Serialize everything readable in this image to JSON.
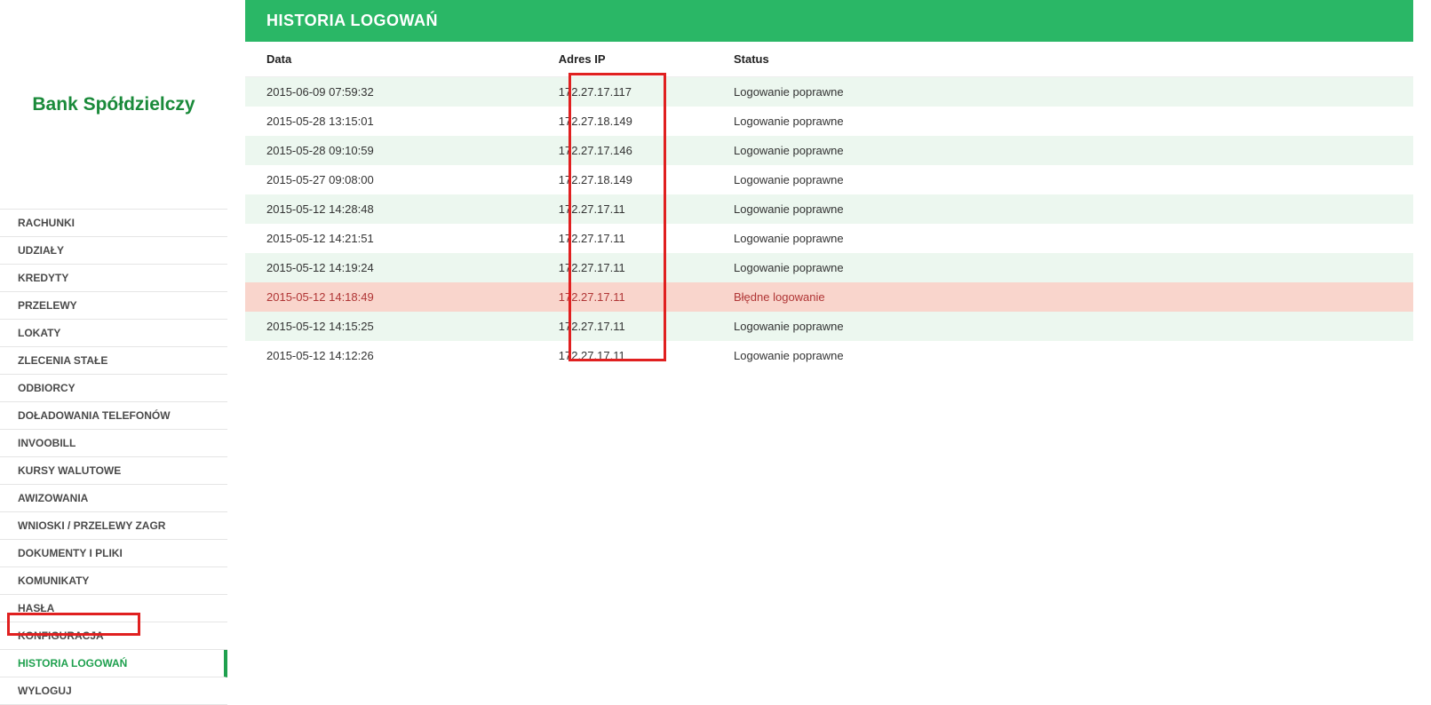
{
  "brand": "Bank Spółdzielczy",
  "page_title": "HISTORIA LOGOWAŃ",
  "nav": [
    {
      "label": "RACHUNKI",
      "active": false
    },
    {
      "label": "UDZIAŁY",
      "active": false
    },
    {
      "label": "KREDYTY",
      "active": false
    },
    {
      "label": "PRZELEWY",
      "active": false
    },
    {
      "label": "LOKATY",
      "active": false
    },
    {
      "label": "ZLECENIA STAŁE",
      "active": false
    },
    {
      "label": "ODBIORCY",
      "active": false
    },
    {
      "label": "DOŁADOWANIA TELEFONÓW",
      "active": false
    },
    {
      "label": "INVOOBILL",
      "active": false
    },
    {
      "label": "KURSY WALUTOWE",
      "active": false
    },
    {
      "label": "AWIZOWANIA",
      "active": false
    },
    {
      "label": "WNIOSKI / PRZELEWY ZAGR",
      "active": false
    },
    {
      "label": "DOKUMENTY I PLIKI",
      "active": false
    },
    {
      "label": "KOMUNIKATY",
      "active": false
    },
    {
      "label": "HASŁA",
      "active": false
    },
    {
      "label": "KONFIGURACJA",
      "active": false
    },
    {
      "label": "HISTORIA LOGOWAŃ",
      "active": true
    },
    {
      "label": "WYLOGUJ",
      "active": false
    }
  ],
  "columns": {
    "date": "Data",
    "ip": "Adres IP",
    "status": "Status"
  },
  "rows": [
    {
      "date": "2015-06-09 07:59:32",
      "ip": "172.27.17.117",
      "status": "Logowanie poprawne",
      "type": "alt"
    },
    {
      "date": "2015-05-28 13:15:01",
      "ip": "172.27.18.149",
      "status": "Logowanie poprawne",
      "type": ""
    },
    {
      "date": "2015-05-28 09:10:59",
      "ip": "172.27.17.146",
      "status": "Logowanie poprawne",
      "type": "alt"
    },
    {
      "date": "2015-05-27 09:08:00",
      "ip": "172.27.18.149",
      "status": "Logowanie poprawne",
      "type": ""
    },
    {
      "date": "2015-05-12 14:28:48",
      "ip": "172.27.17.11",
      "status": "Logowanie poprawne",
      "type": "alt"
    },
    {
      "date": "2015-05-12 14:21:51",
      "ip": "172.27.17.11",
      "status": "Logowanie poprawne",
      "type": ""
    },
    {
      "date": "2015-05-12 14:19:24",
      "ip": "172.27.17.11",
      "status": "Logowanie poprawne",
      "type": "alt"
    },
    {
      "date": "2015-05-12 14:18:49",
      "ip": "172.27.17.11",
      "status": "Błędne logowanie",
      "type": "err"
    },
    {
      "date": "2015-05-12 14:15:25",
      "ip": "172.27.17.11",
      "status": "Logowanie poprawne",
      "type": "alt"
    },
    {
      "date": "2015-05-12 14:12:26",
      "ip": "172.27.17.11",
      "status": "Logowanie poprawne",
      "type": ""
    }
  ]
}
